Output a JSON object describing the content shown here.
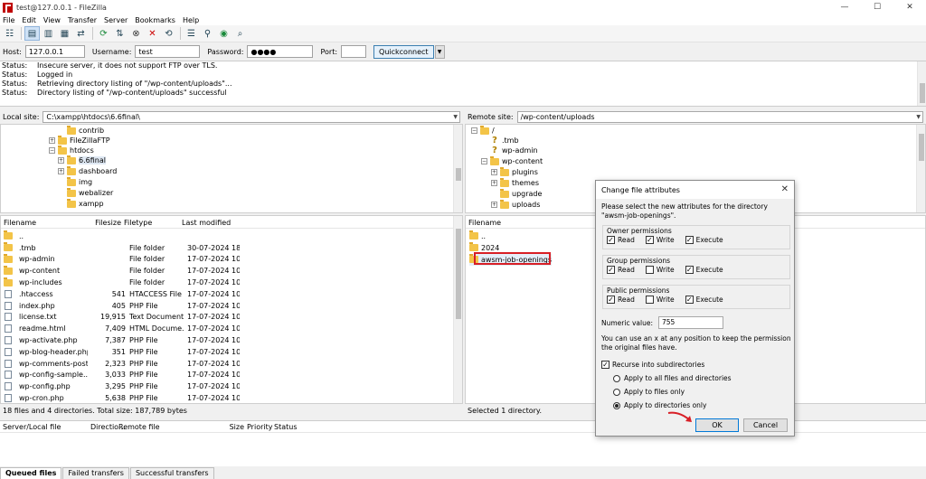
{
  "window": {
    "title": "test@127.0.0.1 - FileZilla",
    "min": "—",
    "max": "☐",
    "close": "✕"
  },
  "menu": [
    "File",
    "Edit",
    "View",
    "Transfer",
    "Server",
    "Bookmarks",
    "Help"
  ],
  "quickconnect": {
    "host_label": "Host:",
    "host_value": "127.0.0.1",
    "username_label": "Username:",
    "username_value": "test",
    "password_label": "Password:",
    "password_value": "●●●●",
    "port_label": "Port:",
    "port_value": "",
    "button": "Quickconnect"
  },
  "log": [
    {
      "k": "Status:",
      "v": "Insecure server, it does not support FTP over TLS."
    },
    {
      "k": "Status:",
      "v": "Logged in"
    },
    {
      "k": "Status:",
      "v": "Retrieving directory listing of \"/wp-content/uploads\"..."
    },
    {
      "k": "Status:",
      "v": "Directory listing of \"/wp-content/uploads\" successful"
    }
  ],
  "local": {
    "label": "Local site:",
    "path": "C:\\xampp\\htdocs\\6.6final\\",
    "tree": [
      "contrib",
      "FileZillaFTP",
      "htdocs",
      "6.6final",
      "dashboard",
      "img",
      "webalizer",
      "xampp"
    ],
    "headers": {
      "name": "Filename",
      "size": "Filesize",
      "type": "Filetype",
      "modified": "Last modified"
    },
    "files": [
      {
        "name": "..",
        "size": "",
        "type": "",
        "modified": ""
      },
      {
        "name": ".tmb",
        "size": "",
        "type": "File folder",
        "modified": "30-07-2024 18:..."
      },
      {
        "name": "wp-admin",
        "size": "",
        "type": "File folder",
        "modified": "17-07-2024 10:..."
      },
      {
        "name": "wp-content",
        "size": "",
        "type": "File folder",
        "modified": "17-07-2024 10:..."
      },
      {
        "name": "wp-includes",
        "size": "",
        "type": "File folder",
        "modified": "17-07-2024 10:..."
      },
      {
        "name": ".htaccess",
        "size": "541",
        "type": "HTACCESS File",
        "modified": "17-07-2024 10:..."
      },
      {
        "name": "index.php",
        "size": "405",
        "type": "PHP File",
        "modified": "17-07-2024 10:..."
      },
      {
        "name": "license.txt",
        "size": "19,915",
        "type": "Text Document",
        "modified": "17-07-2024 10:..."
      },
      {
        "name": "readme.html",
        "size": "7,409",
        "type": "HTML Docume...",
        "modified": "17-07-2024 10:..."
      },
      {
        "name": "wp-activate.php",
        "size": "7,387",
        "type": "PHP File",
        "modified": "17-07-2024 10:..."
      },
      {
        "name": "wp-blog-header.php",
        "size": "351",
        "type": "PHP File",
        "modified": "17-07-2024 10:..."
      },
      {
        "name": "wp-comments-post....",
        "size": "2,323",
        "type": "PHP File",
        "modified": "17-07-2024 10:..."
      },
      {
        "name": "wp-config-sample....",
        "size": "3,033",
        "type": "PHP File",
        "modified": "17-07-2024 10:..."
      },
      {
        "name": "wp-config.php",
        "size": "3,295",
        "type": "PHP File",
        "modified": "17-07-2024 10:..."
      },
      {
        "name": "wp-cron.php",
        "size": "5,638",
        "type": "PHP File",
        "modified": "17-07-2024 10:..."
      }
    ],
    "status": "18 files and 4 directories. Total size: 187,789 bytes"
  },
  "remote": {
    "label": "Remote site:",
    "path": "/wp-content/uploads",
    "tree": [
      "/",
      ".tmb",
      "wp-admin",
      "wp-content",
      "plugins",
      "themes",
      "upgrade",
      "uploads"
    ],
    "headers": {
      "name": "Filename"
    },
    "files": [
      "..",
      "2024",
      "awsm-job-openings"
    ],
    "status": "Selected 1 directory."
  },
  "queue": {
    "headers": [
      "Server/Local file",
      "Directio...",
      "Remote file",
      "Size",
      "Priority",
      "Status"
    ],
    "tabs": [
      "Queued files",
      "Failed transfers",
      "Successful transfers"
    ]
  },
  "dialog": {
    "title": "Change file attributes",
    "desc": "Please select the new attributes for the directory \"awsm-job-openings\".",
    "groups": [
      {
        "title": "Owner permissions",
        "read": true,
        "write": true,
        "execute": true
      },
      {
        "title": "Group permissions",
        "read": true,
        "write": false,
        "execute": true
      },
      {
        "title": "Public permissions",
        "read": true,
        "write": false,
        "execute": true
      }
    ],
    "labels": {
      "read": "Read",
      "write": "Write",
      "execute": "Execute"
    },
    "numeric_label": "Numeric value:",
    "numeric_value": "755",
    "note": "You can use an x at any position to keep the permission the original files have.",
    "recurse_label": "Recurse into subdirectories",
    "recurse_checked": true,
    "options": [
      "Apply to all files and directories",
      "Apply to files only",
      "Apply to directories only"
    ],
    "selected_option": 2,
    "ok": "OK",
    "cancel": "Cancel"
  },
  "colors": {
    "highlight": "#d81f26",
    "accent": "#0078d7"
  }
}
